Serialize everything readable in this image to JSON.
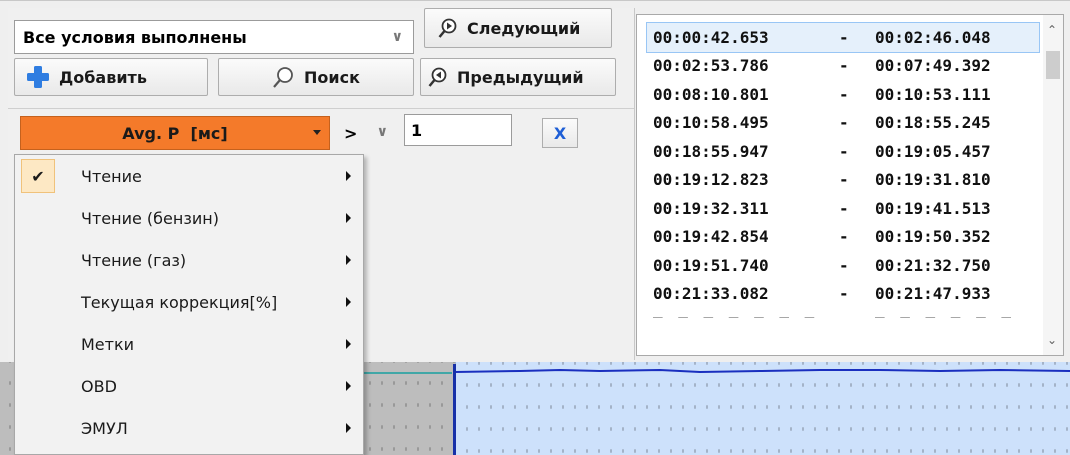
{
  "filter": {
    "condition_mode": "Все условия выполнены",
    "next_label": "Следующий",
    "prev_label": "Предыдущий",
    "add_label": "Добавить",
    "search_label": "Поиск"
  },
  "condition_row": {
    "parameter": "Avg. P  [мс]",
    "operator": ">",
    "value": "1",
    "remove_label": "X"
  },
  "intervals": [
    {
      "start": "00:00:42.653",
      "sep": "-",
      "end": "00:02:46.048"
    },
    {
      "start": "00:02:53.786",
      "sep": "-",
      "end": "00:07:49.392"
    },
    {
      "start": "00:08:10.801",
      "sep": "-",
      "end": "00:10:53.111"
    },
    {
      "start": "00:10:58.495",
      "sep": "-",
      "end": "00:18:55.245"
    },
    {
      "start": "00:18:55.947",
      "sep": "-",
      "end": "00:19:05.457"
    },
    {
      "start": "00:19:12.823",
      "sep": "-",
      "end": "00:19:31.810"
    },
    {
      "start": "00:19:32.311",
      "sep": "-",
      "end": "00:19:41.513"
    },
    {
      "start": "00:19:42.854",
      "sep": "-",
      "end": "00:19:50.352"
    },
    {
      "start": "00:19:51.740",
      "sep": "-",
      "end": "00:21:32.750"
    },
    {
      "start": "00:21:33.082",
      "sep": "-",
      "end": "00:21:47.933"
    }
  ],
  "context_menu": {
    "items": [
      {
        "label": "Чтение",
        "checked": true
      },
      {
        "label": "Чтение (бензин)",
        "checked": false
      },
      {
        "label": "Чтение (газ)",
        "checked": false
      },
      {
        "label": "Текущая коррекция[%]",
        "checked": false
      },
      {
        "label": "Метки",
        "checked": false
      },
      {
        "label": "OBD",
        "checked": false
      },
      {
        "label": "ЭМУЛ",
        "checked": false
      }
    ]
  },
  "colors": {
    "param_button": "#f47a2a",
    "chart_bg": "#cde1fb",
    "chart_line": "#1a2fbf",
    "remove_x": "#1f5fd6"
  }
}
